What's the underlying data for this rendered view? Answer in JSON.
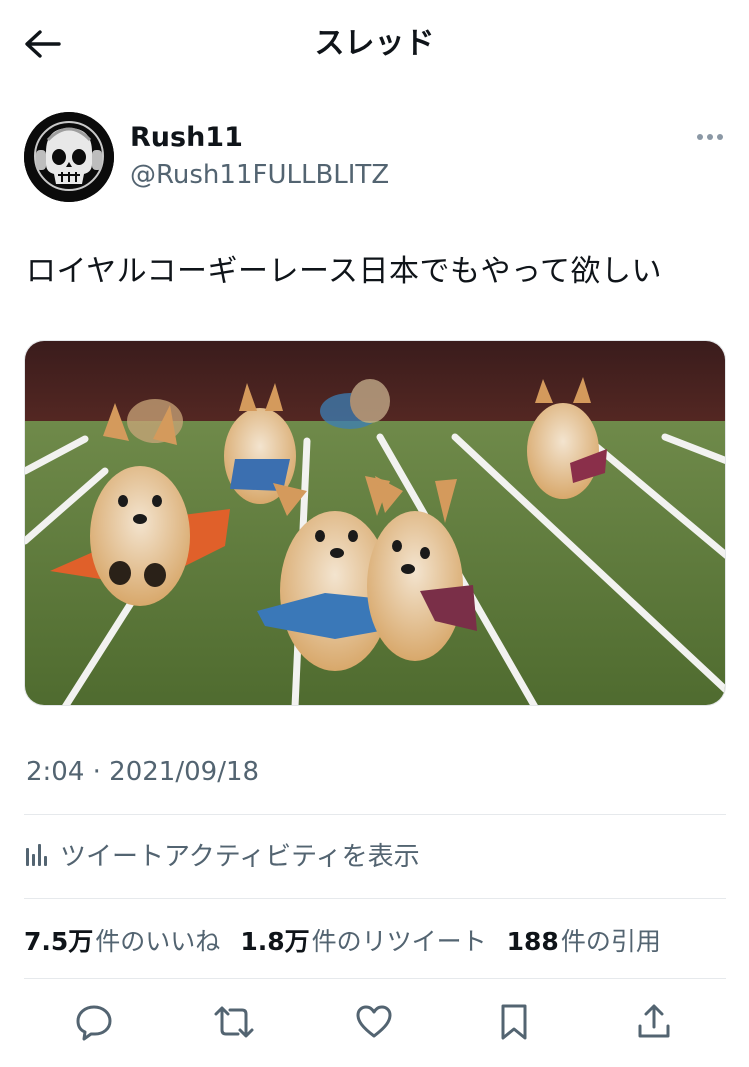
{
  "header": {
    "title": "スレッド",
    "back_icon": "arrow-left-icon"
  },
  "tweet": {
    "display_name": "Rush11",
    "handle": "@Rush11FULLBLITZ",
    "text": "ロイヤルコーギーレース日本でもやって欲しい",
    "media_alt": "corgi-race-photo",
    "timestamp": "2:04 · 2021/09/18",
    "activity_label": "ツイートアクティビティを表示",
    "stats": {
      "likes_count": "7.5万",
      "likes_label": "件のいいね",
      "retweets_count": "1.8万",
      "retweets_label": "件のリツイート",
      "quotes_count": "188",
      "quotes_label": "件の引用"
    }
  },
  "actions": [
    "reply-icon",
    "retweet-icon",
    "like-icon",
    "bookmark-icon",
    "share-icon"
  ],
  "colors": {
    "text_primary": "#0f1419",
    "text_secondary": "#536471",
    "divider": "#e6e9ec"
  }
}
